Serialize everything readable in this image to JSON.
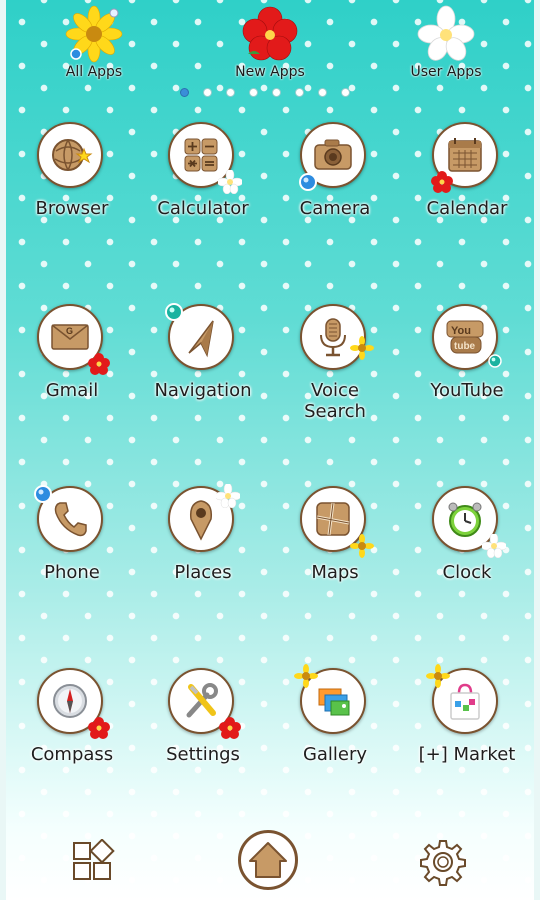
{
  "categories": [
    {
      "label": "All Apps",
      "flower": "yellow-flower-icon",
      "active": true
    },
    {
      "label": "New Apps",
      "flower": "red-hibiscus-icon"
    },
    {
      "label": "User Apps",
      "flower": "white-plumeria-icon"
    }
  ],
  "page_indicator": {
    "count": 8,
    "current": 1
  },
  "apps": [
    {
      "label": "Browser",
      "icon": "browser-icon"
    },
    {
      "label": "Calculator",
      "icon": "calculator-icon"
    },
    {
      "label": "Camera",
      "icon": "camera-icon"
    },
    {
      "label": "Calendar",
      "icon": "calendar-icon"
    },
    {
      "label": "Gmail",
      "icon": "gmail-icon"
    },
    {
      "label": "Navigation",
      "icon": "navigation-icon"
    },
    {
      "label": "Voice\nSearch",
      "icon": "voice-search-icon"
    },
    {
      "label": "YouTube",
      "icon": "youtube-icon"
    },
    {
      "label": "Phone",
      "icon": "phone-icon"
    },
    {
      "label": "Places",
      "icon": "places-icon"
    },
    {
      "label": "Maps",
      "icon": "maps-icon"
    },
    {
      "label": "Clock",
      "icon": "clock-icon"
    },
    {
      "label": "Compass",
      "icon": "compass-icon"
    },
    {
      "label": "Settings",
      "icon": "settings-icon"
    },
    {
      "label": "Gallery",
      "icon": "gallery-icon"
    },
    {
      "label": "[+] Market",
      "icon": "market-icon"
    }
  ],
  "bottom_bar": {
    "left": "app-drawer-icon",
    "center": "home-icon",
    "right": "gear-icon"
  },
  "colors": {
    "background_top": "#2fd0c8",
    "background_bottom": "#ffffff",
    "wood": "#c79a66",
    "wood_dark": "#7a5330"
  }
}
